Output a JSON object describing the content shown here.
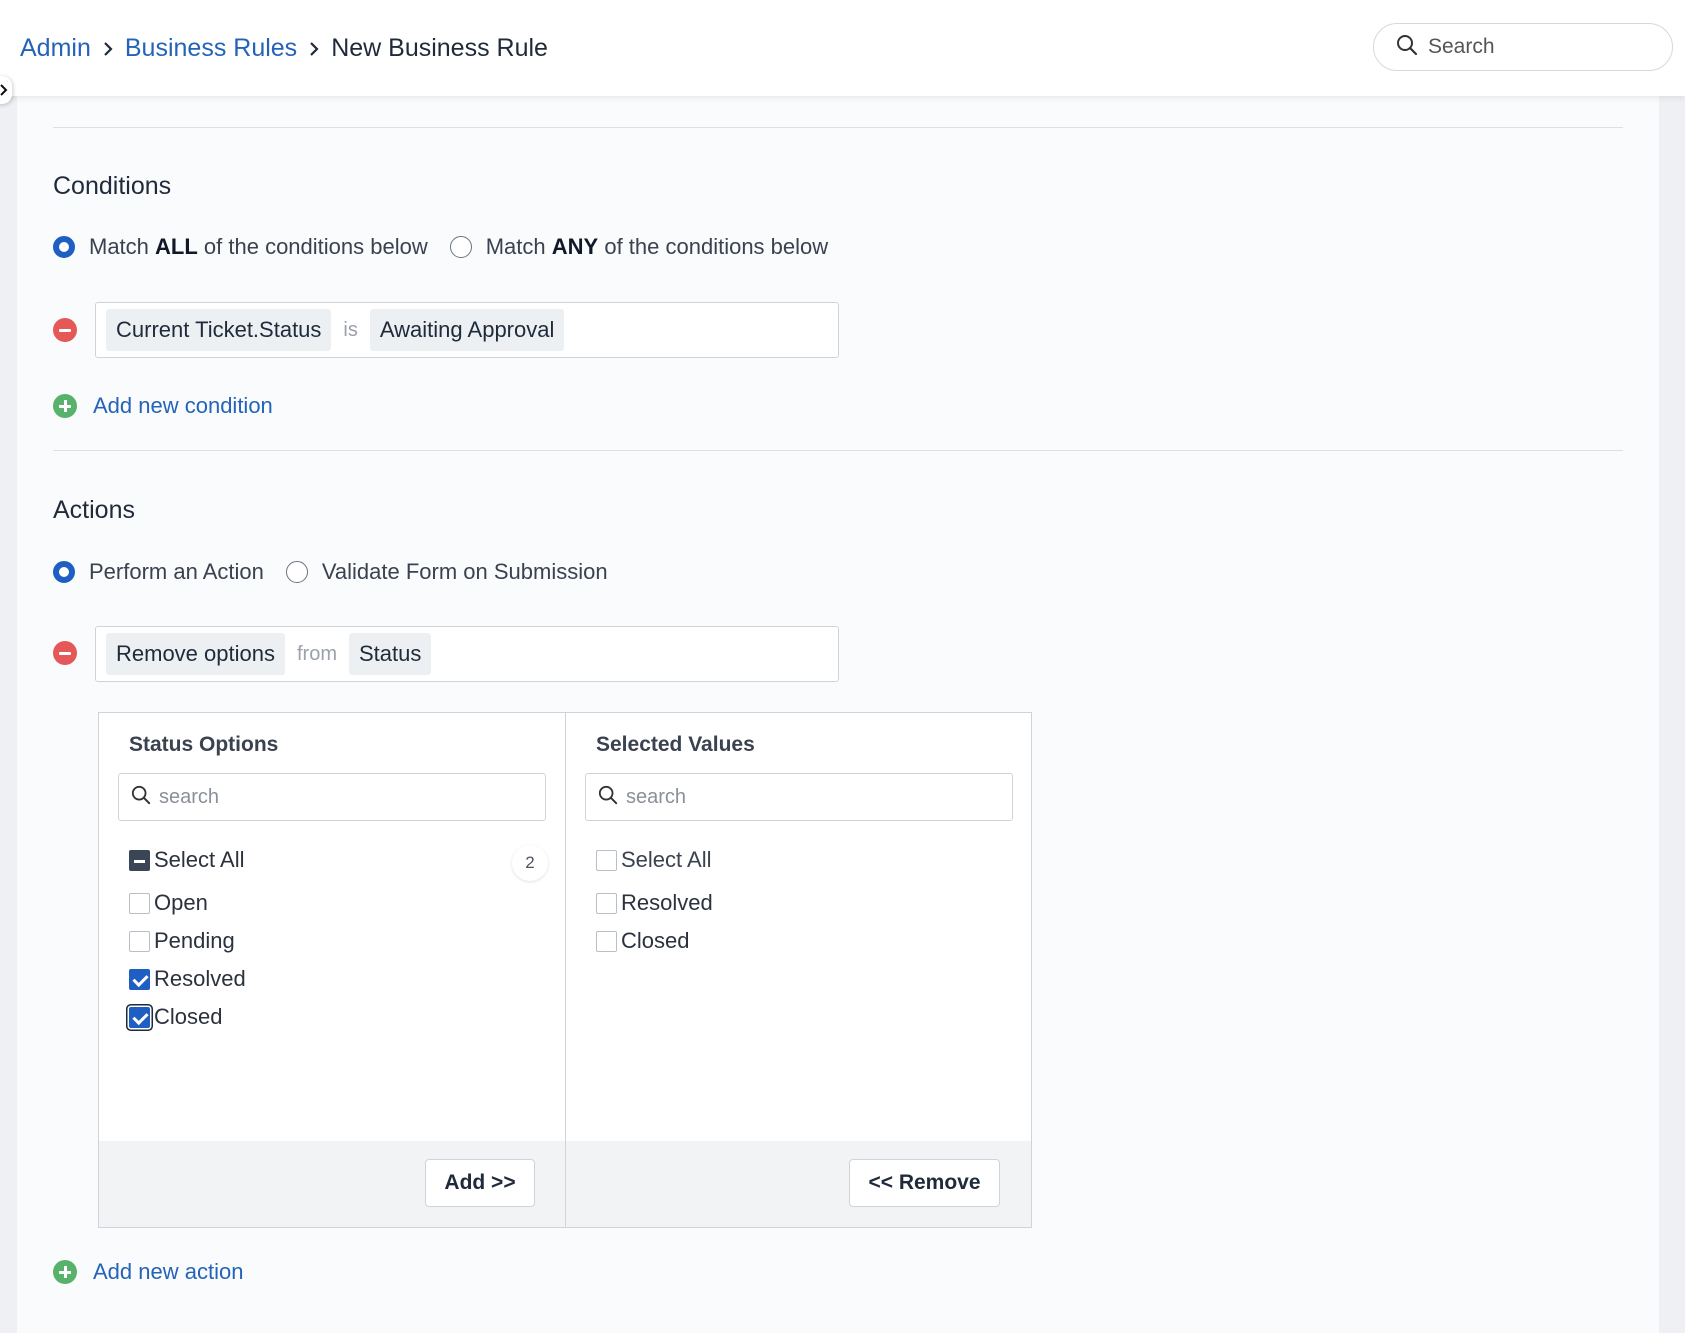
{
  "breadcrumb": {
    "admin": "Admin",
    "business_rules": "Business Rules",
    "current": "New Business Rule"
  },
  "search": {
    "placeholder": "Search"
  },
  "conditions": {
    "title": "Conditions",
    "match_all": {
      "prefix": "Match ",
      "keyword": "ALL",
      "suffix": " of the conditions below",
      "selected": true
    },
    "match_any": {
      "prefix": "Match ",
      "keyword": "ANY",
      "suffix": " of the conditions below",
      "selected": false
    },
    "rule": {
      "field": "Current Ticket.Status",
      "operator": "is",
      "value": "Awaiting Approval"
    },
    "add_label": "Add new condition"
  },
  "actions": {
    "title": "Actions",
    "perform": {
      "label": "Perform an Action",
      "selected": true
    },
    "validate": {
      "label": "Validate Form on Submission",
      "selected": false
    },
    "rule": {
      "action": "Remove options",
      "operator": "from",
      "target": "Status"
    },
    "add_label": "Add new action"
  },
  "status_options": {
    "title": "Status Options",
    "search_placeholder": "search",
    "select_all": "Select All",
    "selected_count": "2",
    "items": [
      {
        "label": "Open",
        "checked": false
      },
      {
        "label": "Pending",
        "checked": false
      },
      {
        "label": "Resolved",
        "checked": true
      },
      {
        "label": "Closed",
        "checked": true
      }
    ],
    "add_button": "Add >>"
  },
  "selected_values": {
    "title": "Selected Values",
    "search_placeholder": "search",
    "select_all": "Select All",
    "items": [
      {
        "label": "Resolved",
        "checked": false
      },
      {
        "label": "Closed",
        "checked": false
      }
    ],
    "remove_button": "<< Remove"
  },
  "colors": {
    "link": "#2563b8",
    "primary": "#1f5fc4",
    "danger": "#e45858",
    "success": "#58b26b"
  }
}
